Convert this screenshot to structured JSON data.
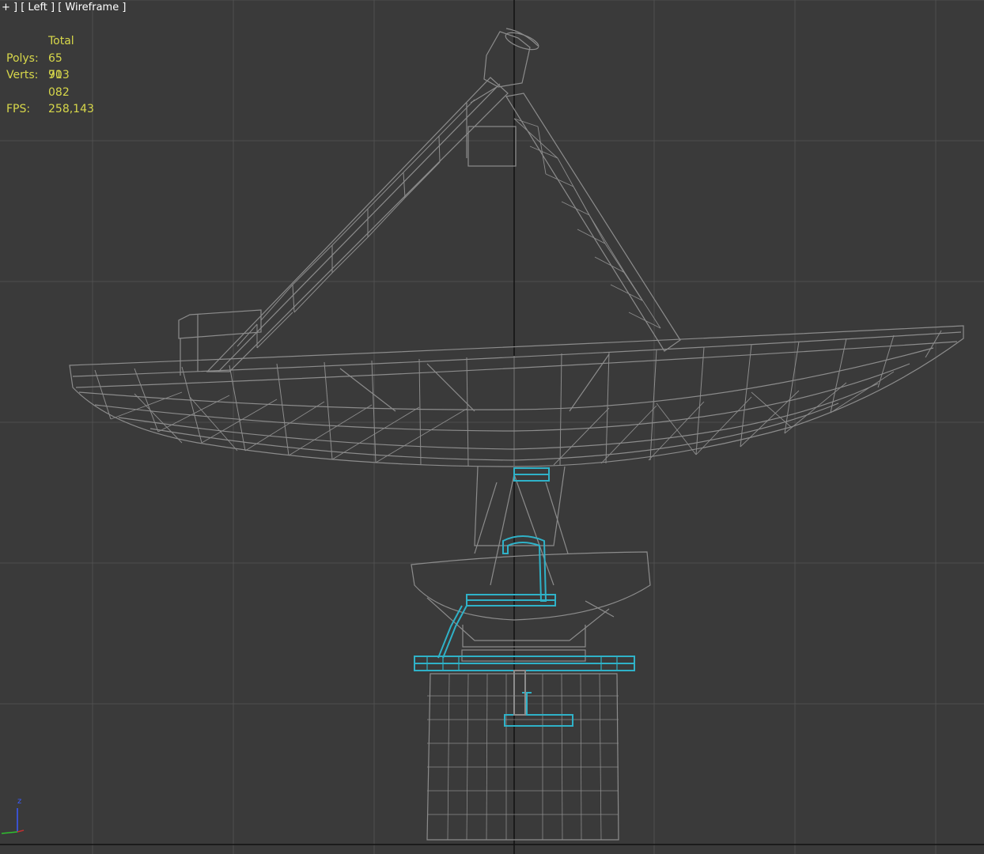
{
  "viewport": {
    "label": "+ ] [ Left ] [ Wireframe ]"
  },
  "stats": {
    "header": "Total",
    "polys_label": "Polys:",
    "polys_value": "65 913",
    "verts_label": "Verts:",
    "verts_value": "70 082",
    "fps_label": "FPS:",
    "fps_value": "258,143"
  },
  "axis": {
    "z_label": "z"
  },
  "colors": {
    "background": "#3a3a3a",
    "grid": "#4f4f4f",
    "grid_axis": "#111111",
    "wireframe": "#8c8c8c",
    "selection": "#2fb2c8",
    "stats_text": "#d8d84a",
    "label_text": "#ffffff"
  }
}
